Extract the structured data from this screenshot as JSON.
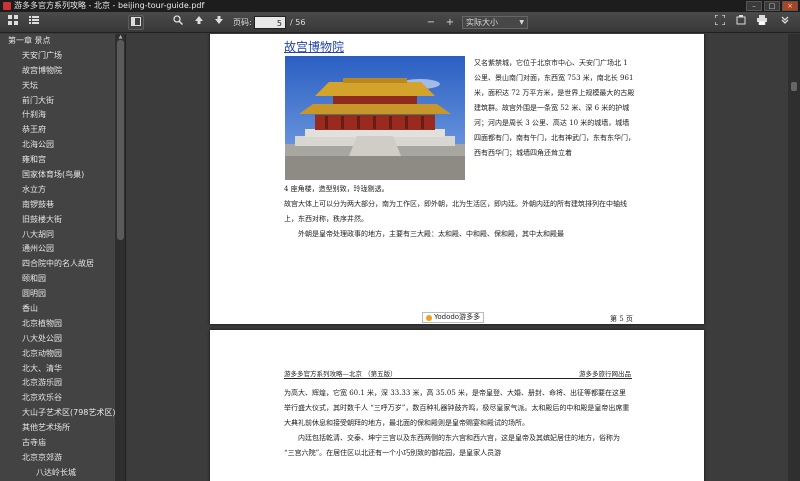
{
  "window": {
    "title": "游多多官方系列攻略 - 北京 - beijing-tour-guide.pdf",
    "controls": [
      "–",
      "□",
      "×"
    ]
  },
  "toolbar": {
    "page_label": "页码:",
    "page_current": "5",
    "page_total": "/ 56",
    "zoom_out": "−",
    "zoom_in": "+",
    "zoom_value": "实际大小",
    "icons": [
      "thumbnails-icon",
      "outline-icon",
      "sidebar-toggle-icon",
      "search-icon",
      "prev-page-icon",
      "next-page-icon",
      "fit-width-icon",
      "rotate-icon",
      "print-icon",
      "more-icon"
    ]
  },
  "sidebar": {
    "items": [
      {
        "label": "第一章 景点",
        "level": 0
      },
      {
        "label": "天安门广场",
        "level": 1
      },
      {
        "label": "故宫博物院",
        "level": 1
      },
      {
        "label": "天坛",
        "level": 1
      },
      {
        "label": "前门大街",
        "level": 1
      },
      {
        "label": "什刹海",
        "level": 1
      },
      {
        "label": "恭王府",
        "level": 1
      },
      {
        "label": "北海公园",
        "level": 1
      },
      {
        "label": "雍和宫",
        "level": 1
      },
      {
        "label": "国家体育场(鸟巢)",
        "level": 1
      },
      {
        "label": "水立方",
        "level": 1
      },
      {
        "label": "南锣鼓巷",
        "level": 1
      },
      {
        "label": "旧鼓楼大街",
        "level": 1
      },
      {
        "label": "八大胡同",
        "level": 1
      },
      {
        "label": "通州公园",
        "level": 1
      },
      {
        "label": "四合院中的名人故居",
        "level": 1
      },
      {
        "label": "颐和园",
        "level": 1
      },
      {
        "label": "圆明园",
        "level": 1
      },
      {
        "label": "香山",
        "level": 1
      },
      {
        "label": "北京植物园",
        "level": 1
      },
      {
        "label": "八大处公园",
        "level": 1
      },
      {
        "label": "北京动物园",
        "level": 1
      },
      {
        "label": "北大、清华",
        "level": 1
      },
      {
        "label": "北京游乐园",
        "level": 1
      },
      {
        "label": "北京欢乐谷",
        "level": 1
      },
      {
        "label": "大山子艺术区(798艺术区)",
        "level": 1
      },
      {
        "label": "其他艺术场所",
        "level": 1
      },
      {
        "label": "古寺庙",
        "level": 1
      },
      {
        "label": "北京京郊游",
        "level": 1
      },
      {
        "label": "八达岭长城",
        "level": 2
      }
    ]
  },
  "page1": {
    "title": "故宫博物院",
    "right_col": "又名紫禁城，它位于北京市中心、天安门广场北 1 公里、景山南门对面，东西宽 753 米，南北长 961 米，面积达 72 万平方米，是世界上规模最大的古殿建筑群。故宫外围是一条宽 52 米、深 6 米的护城河；河内是周长 3 公里、高达 10 米的城墙，城墙四面都有门，南有午门，北有神武门，东有东华门，西有西华门；城墙四角还耸立着",
    "line2": "4 座角楼，造型别致，玲珑剔透。",
    "para2": "故宫大体上可以分为两大部分，南为工作区，即外朝，北为生活区，即内廷。外朝内廷的所有建筑排列在中轴线上，东西对称，秩序井然。",
    "para3": "外朝是皇帝处理政事的地方，主要有三大殿：太和殿、中和殿、保和殿，其中太和殿最",
    "logo": "Yododo游多多",
    "page_number": "第 5 页"
  },
  "page2": {
    "header_left": "游多多官方系列攻略—北京 （第五版）",
    "header_right": "游多多旅行网出品",
    "para1": "为高大、辉煌，它宽 60.1 米，深 33.33 米，高 35.05 米，是帝皇登、大婚、册封、命将、出征等都要在这里举行盛大仪式，其时数千人 “三呼万岁”，数百种礼器钟鼓齐鸣，极尽皇家气派。太和殿后的中和殿是皇帝出席重大典礼前休息和接受朝拜的地方，最北面的保和殿则是皇帝赐宴和殿试的场所。",
    "para2": "内廷包括乾清、交泰、坤宁三宫以及东西两侧的东六宫和西六宫，这是皇帝及其嫔妃居住的地方，俗称为 “三宫六院”。在居住区以北还有一个小巧别致的御花园，是皇家人员游"
  }
}
